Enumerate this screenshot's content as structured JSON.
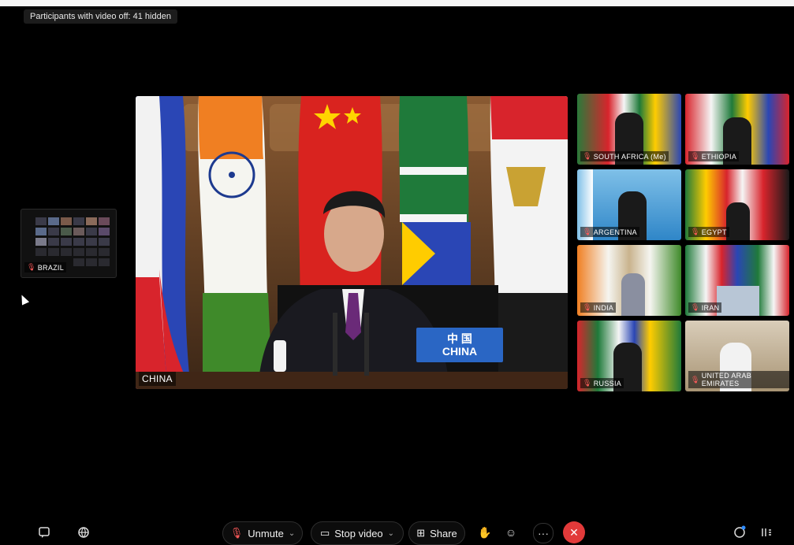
{
  "banner": {
    "hidden_text": "Participants with video off: 41 hidden"
  },
  "main_speaker": {
    "label": "CHINA",
    "nameplate_line1": "中 国",
    "nameplate_line2": "CHINA"
  },
  "participants": [
    {
      "label": "SOUTH AFRICA (Me)",
      "muted": true
    },
    {
      "label": "ETHIOPIA",
      "muted": true
    },
    {
      "label": "ARGENTINA",
      "muted": true
    },
    {
      "label": "EGYPT",
      "muted": true
    },
    {
      "label": "INDIA",
      "muted": true
    },
    {
      "label": "IRAN",
      "muted": true
    },
    {
      "label": "RUSSIA",
      "muted": true
    },
    {
      "label": "UNITED ARAB EMIRATES",
      "muted": true
    }
  ],
  "side_tile": {
    "label": "BRAZIL"
  },
  "toolbar": {
    "unmute_label": "Unmute",
    "stop_video_label": "Stop video",
    "share_label": "Share",
    "more_label": "···",
    "end_label": "✕"
  },
  "colors": {
    "end_button": "#e23a3a",
    "mic_muted": "#ff5a5a",
    "accent": "#2f8cff"
  }
}
